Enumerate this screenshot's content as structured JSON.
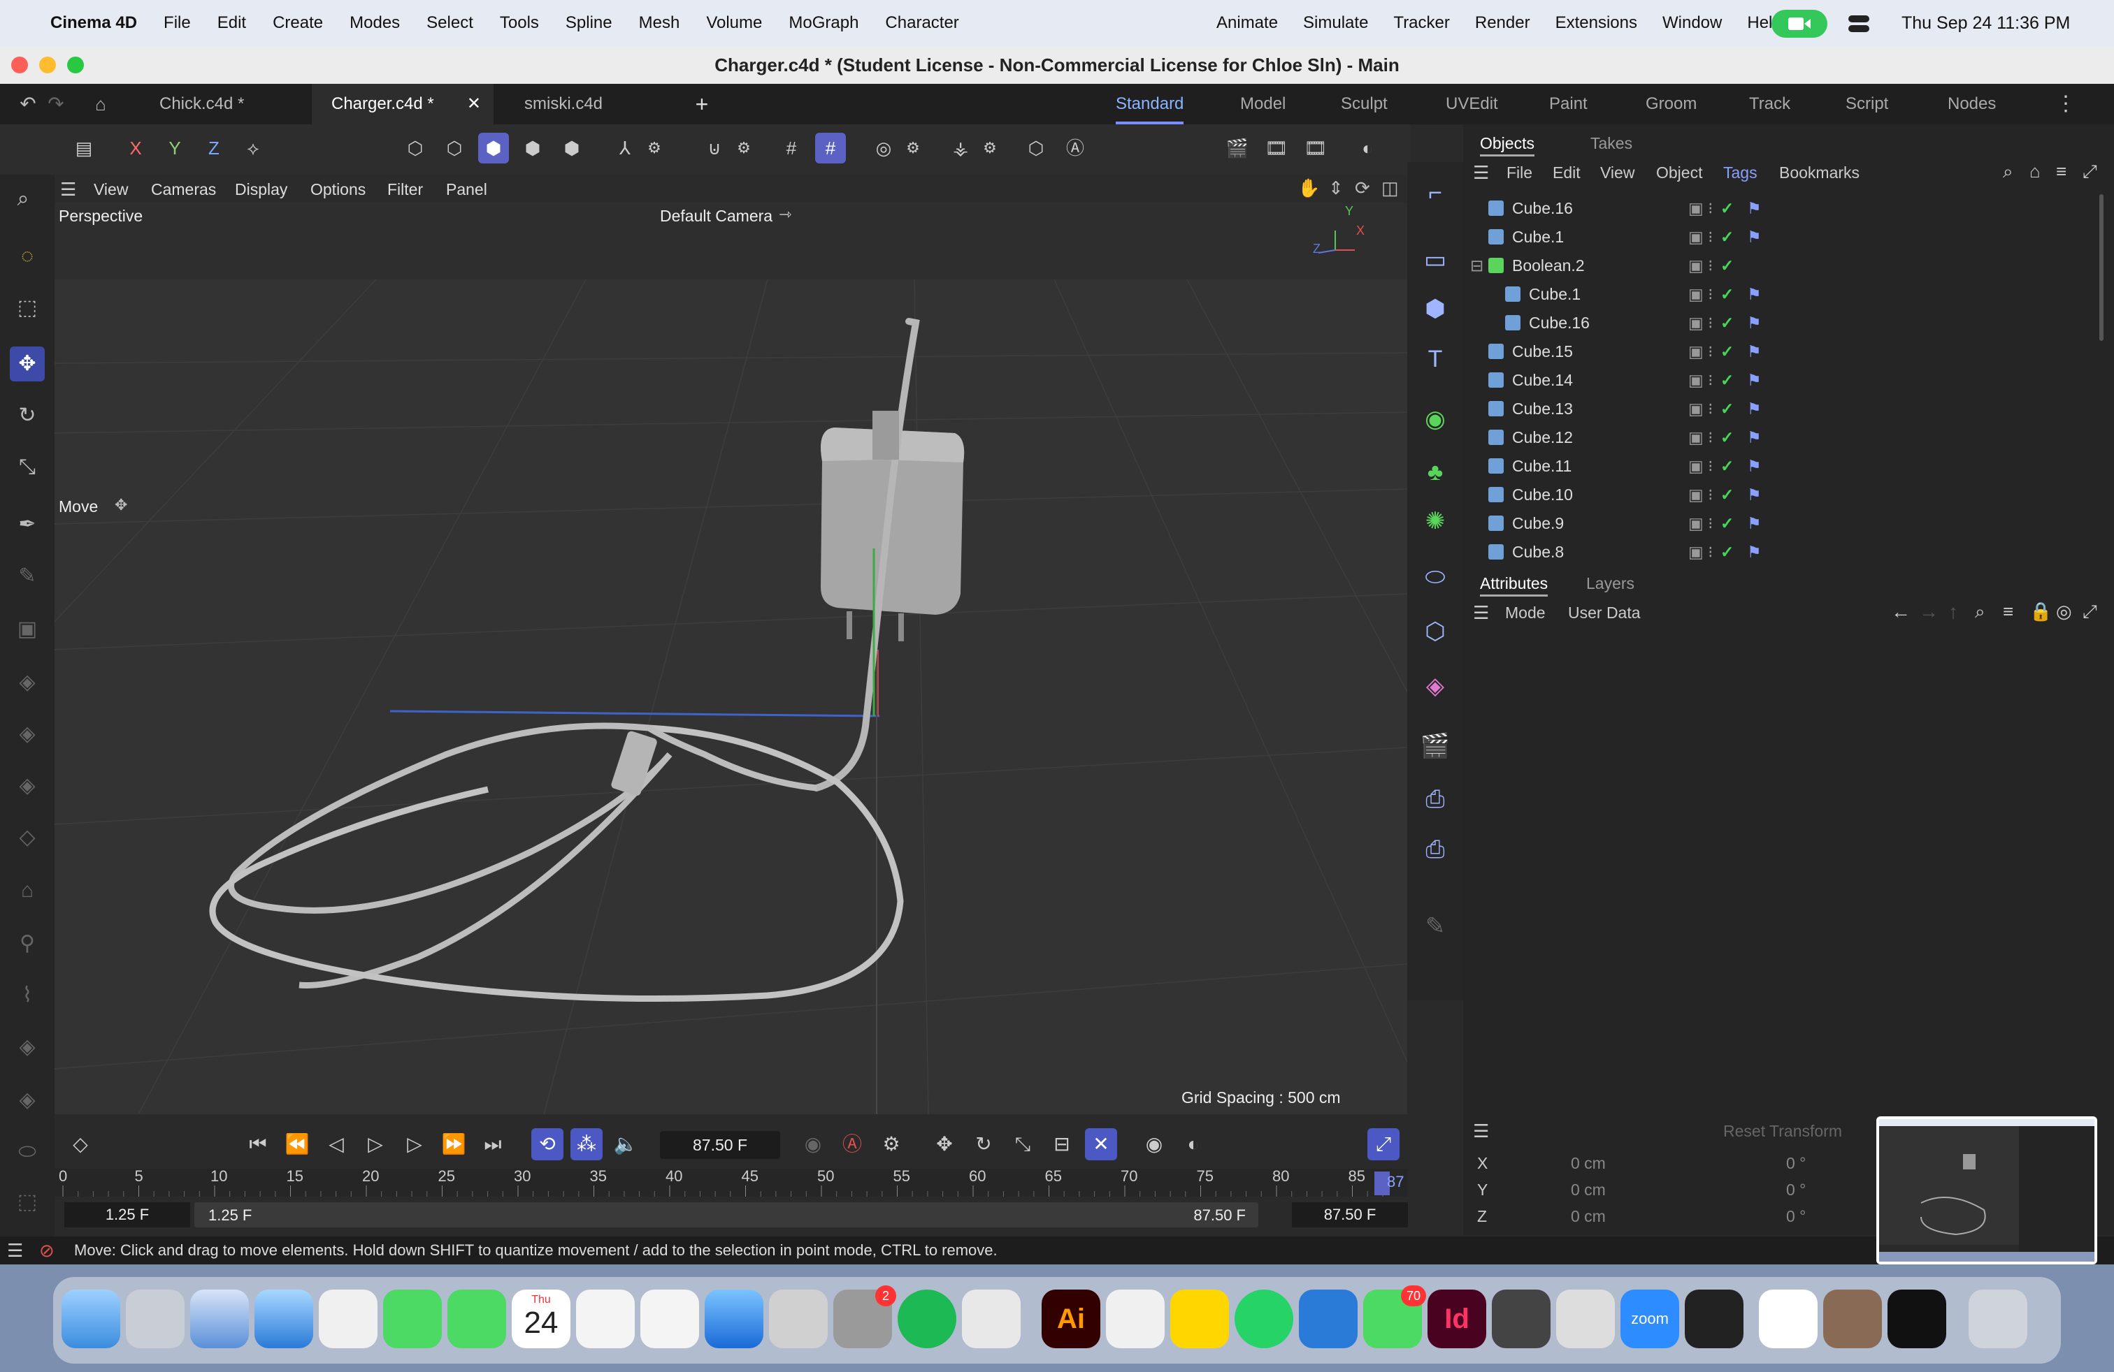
{
  "menubar": {
    "apple": "",
    "app": "Cinema 4D",
    "left_items": [
      "File",
      "Edit",
      "Create",
      "Modes",
      "Select",
      "Tools",
      "Spline",
      "Mesh",
      "Volume",
      "MoGraph",
      "Character"
    ],
    "right_items": [
      "Animate",
      "Simulate",
      "Tracker",
      "Render",
      "Extensions",
      "Window",
      "Help"
    ],
    "datetime": "Thu Sep 24  11:36 PM"
  },
  "window": {
    "title": "Charger.c4d * (Student License - Non-Commercial License for Chloe Sln) - Main"
  },
  "tabs": [
    {
      "label": "Chick.c4d *"
    },
    {
      "label": "Charger.c4d *"
    },
    {
      "label": "smiski.c4d"
    }
  ],
  "tab_close": "✕",
  "tab_add": "+",
  "layouts": [
    "Standard",
    "Model",
    "Sculpt",
    "UVEdit",
    "Paint",
    "Groom",
    "Track",
    "Script",
    "Nodes"
  ],
  "active_layout": "Standard",
  "toolbar": {
    "x": "X",
    "y": "Y",
    "z": "Z"
  },
  "viewport": {
    "menu": [
      "View",
      "Cameras",
      "Display",
      "Options",
      "Filter",
      "Panel"
    ],
    "projection": "Perspective",
    "camera": "Default Camera",
    "tool_label": "Move",
    "grid_spacing": "Grid Spacing : 500 cm",
    "axis_y": "Y",
    "axis_x": "X",
    "axis_z": "Z"
  },
  "objects_panel": {
    "tabs": [
      "Objects",
      "Takes"
    ],
    "menu": [
      "File",
      "Edit",
      "View",
      "Object",
      "Tags",
      "Bookmarks"
    ],
    "rows": [
      {
        "name": "Cube.16",
        "indent": 0,
        "tag": true
      },
      {
        "name": "Cube.1",
        "indent": 0,
        "tag": true
      },
      {
        "name": "Boolean.2",
        "indent": 0,
        "tag": false
      },
      {
        "name": "Cube.1",
        "indent": 1,
        "tag": true
      },
      {
        "name": "Cube.16",
        "indent": 1,
        "tag": true
      },
      {
        "name": "Cube.15",
        "indent": 0,
        "tag": true
      },
      {
        "name": "Cube.14",
        "indent": 0,
        "tag": true
      },
      {
        "name": "Cube.13",
        "indent": 0,
        "tag": true
      },
      {
        "name": "Cube.12",
        "indent": 0,
        "tag": true
      },
      {
        "name": "Cube.11",
        "indent": 0,
        "tag": true
      },
      {
        "name": "Cube.10",
        "indent": 0,
        "tag": true
      },
      {
        "name": "Cube.9",
        "indent": 0,
        "tag": true
      },
      {
        "name": "Cube.8",
        "indent": 0,
        "tag": true
      }
    ]
  },
  "attributes_panel": {
    "tabs": [
      "Attributes",
      "Layers"
    ],
    "menu": [
      "Mode",
      "User Data"
    ]
  },
  "coordinates": {
    "reset_label": "Reset Transform",
    "rows": [
      {
        "axis": "X",
        "pos": "0 cm",
        "rot": "0 °"
      },
      {
        "axis": "Y",
        "pos": "0 cm",
        "rot": "0 °"
      },
      {
        "axis": "Z",
        "pos": "0 cm",
        "rot": "0 °"
      }
    ]
  },
  "timeline": {
    "current_frame": "87.50 F",
    "ticks": [
      "0",
      "5",
      "10",
      "15",
      "20",
      "25",
      "30",
      "35",
      "40",
      "45",
      "50",
      "55",
      "60",
      "65",
      "70",
      "75",
      "80",
      "85"
    ],
    "end_tick": "87",
    "start_min": "1.25 F",
    "start": "1.25 F",
    "end": "87.50 F",
    "end_max": "87.50 F"
  },
  "status_bar": {
    "message": "Move: Click and drag to move elements. Hold down SHIFT to quantize movement / add to the selection in point mode, CTRL to remove."
  },
  "dock": {
    "calendar_month": "Thu",
    "calendar_day": "24",
    "settings_badge": "2",
    "messages_badge": "70",
    "illustrator_label": "Ai",
    "indesign_label": "Id",
    "zoom_label": "zoom"
  }
}
